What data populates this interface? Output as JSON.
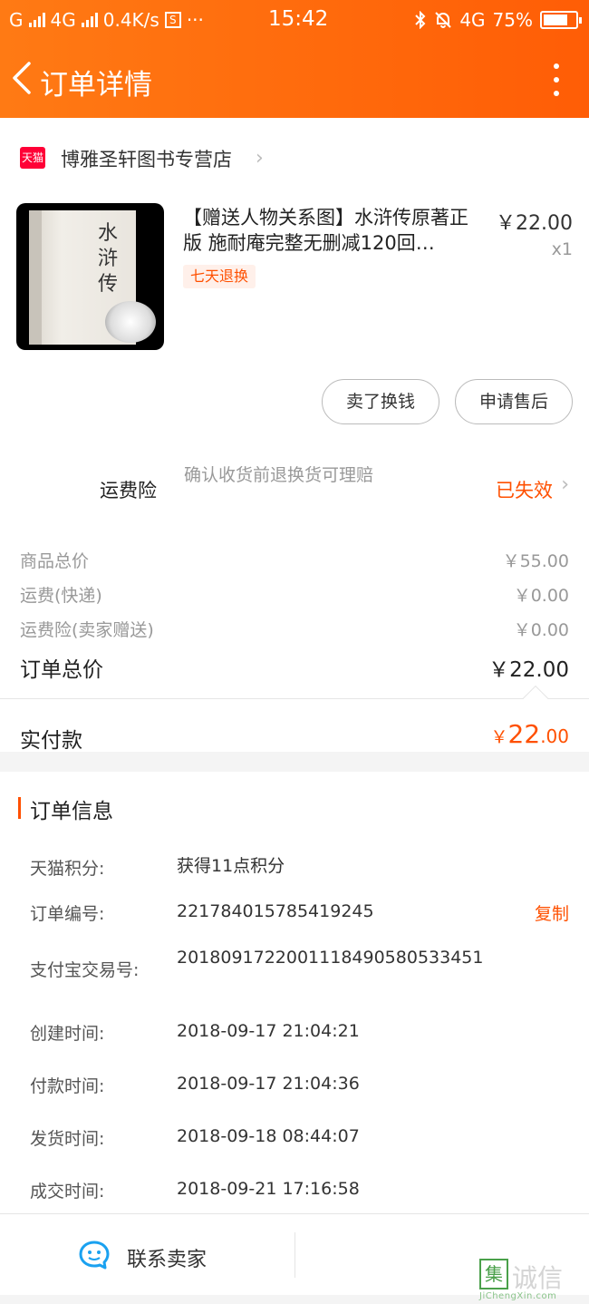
{
  "status_bar": {
    "carrier1": "G",
    "carrier2": "4G",
    "speed": "0.4K/s",
    "s_badge": "S",
    "dots": "···",
    "time": "15:42",
    "net": "4G",
    "battery": "75%",
    "battery_level": 0.75
  },
  "nav": {
    "title": "订单详情"
  },
  "store": {
    "badge": "天猫",
    "name": "博雅圣轩图书专营店",
    "chevron": "›"
  },
  "product": {
    "cover_title": "水浒传",
    "title": "【赠送人物关系图】水浒传原著正版 施耐庵完整无删减120回…",
    "tag": "七天退换",
    "price": "￥22.00",
    "qty": "x1"
  },
  "actions": {
    "sell_label": "卖了换钱",
    "aftersale_label": "申请售后"
  },
  "insurance": {
    "label": "运费险",
    "desc": "确认收货前退换货可理赔",
    "status": "已失效",
    "chevron": "›"
  },
  "summary": {
    "goods_label": "商品总价",
    "goods_value": "￥55.00",
    "shipping_label": "运费(快递)",
    "shipping_value": "￥0.00",
    "ins_label": "运费险(卖家赠送)",
    "ins_value": "￥0.00",
    "total_label": "订单总价",
    "total_value": "￥22.00",
    "paid_label": "实付款",
    "paid_currency": "￥",
    "paid_int": "22",
    "paid_dec": ".00"
  },
  "order_info": {
    "title": "订单信息",
    "rows": [
      {
        "label": "天猫积分:",
        "value": "获得11点积分"
      },
      {
        "label": "订单编号:",
        "value": "221784015785419245"
      },
      {
        "label": "支付宝交易号:",
        "value": "2018091722001118490580533451"
      },
      {
        "label": "创建时间:",
        "value": "2018-09-17 21:04:21"
      },
      {
        "label": "付款时间:",
        "value": "2018-09-17 21:04:36"
      },
      {
        "label": "发货时间:",
        "value": "2018-09-18 08:44:07"
      },
      {
        "label": "成交时间:",
        "value": "2018-09-21 17:16:58"
      }
    ],
    "copy_label": "复制"
  },
  "bottom": {
    "contact_label": "联系卖家"
  },
  "watermark": {
    "box": "集",
    "text": "诚信",
    "url": "JiChengXin.com"
  },
  "colors": {
    "accent": "#ff5000",
    "header": "#ff6a0c",
    "tmall": "#ff0036"
  },
  "icons": {
    "back": "chevron-left-icon",
    "more": "more-vertical-icon",
    "tmall": "tmall-icon",
    "contact": "chat-bubble-icon"
  }
}
